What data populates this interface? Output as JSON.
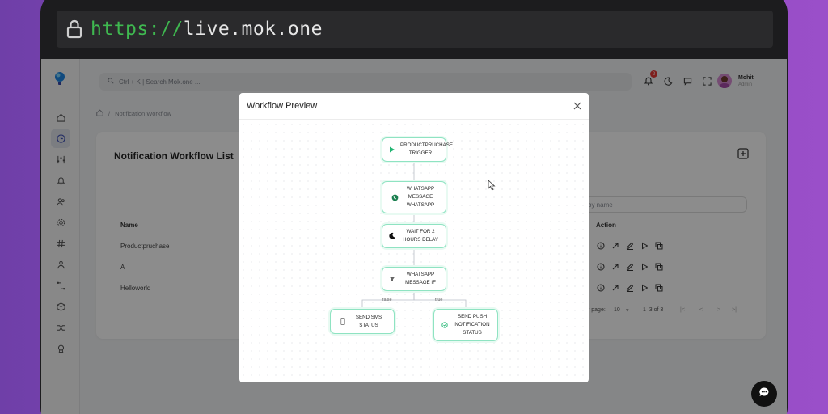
{
  "browser": {
    "url_scheme": "https://",
    "url_host": "live.mok.one"
  },
  "topbar": {
    "search_placeholder": "Ctrl + K | Search Mok.one ...",
    "notification_count": "2",
    "user_name": "Mohit",
    "user_role": "Admin"
  },
  "breadcrumb": {
    "current": "Notification Workflow"
  },
  "page": {
    "title": "Notification Workflow List",
    "filter_placeholder": "by name",
    "col_name": "Name",
    "col_action": "Action",
    "rows": [
      {
        "name": "Productpruchase"
      },
      {
        "name": "A"
      },
      {
        "name": "Helloworld"
      }
    ],
    "rows_per_page_label": "r page:",
    "rows_per_page_value": "10",
    "pagination_range": "1–3 of 3"
  },
  "modal": {
    "title": "Workflow Preview",
    "nodes": {
      "trigger": "PRODUCTPRUCHASE TRIGGER",
      "whatsapp": "WHATSAPP MESSAGE WHATSAPP",
      "wait": "WAIT FOR 2 HOURS DELAY",
      "condition": "WHATSAPP MESSAGE IF",
      "sms": "SEND SMS STATUS",
      "push": "SEND PUSH NOTIFICATION STATUS"
    },
    "edge_false": "false",
    "edge_true": "true"
  },
  "colors": {
    "accent_green": "#8fe3c2",
    "url_scheme": "#3fb950",
    "badge_red": "#e53935"
  }
}
